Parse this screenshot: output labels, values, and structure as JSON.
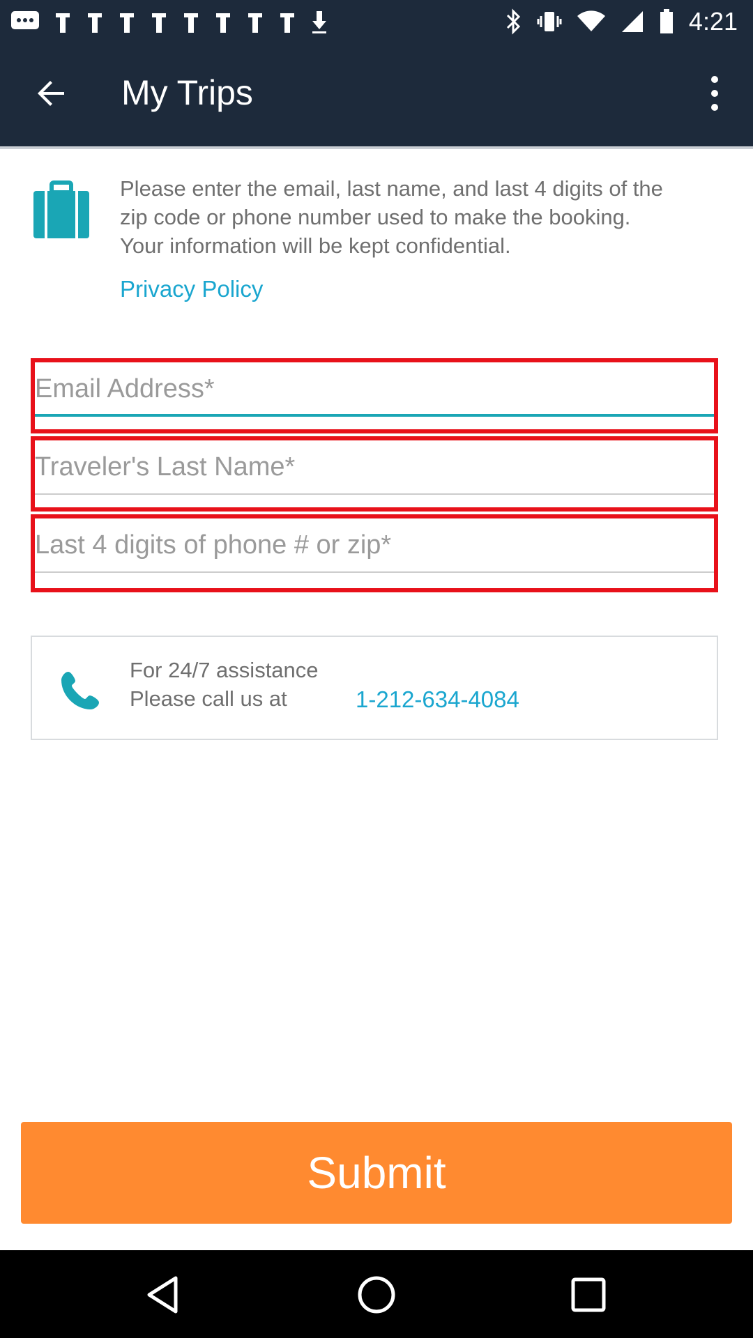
{
  "status_bar": {
    "time": "4:21",
    "left_icons": [
      "chat-bubble-icon",
      "notification-icon",
      "notification-icon",
      "notification-icon",
      "notification-icon",
      "notification-icon",
      "notification-icon",
      "notification-icon",
      "notification-icon",
      "download-icon"
    ],
    "right_icons": [
      "bluetooth-icon",
      "vibrate-icon",
      "wifi-icon",
      "signal-icon",
      "battery-icon"
    ]
  },
  "app_bar": {
    "title": "My Trips",
    "back_icon": "arrow-back-icon",
    "more_icon": "more-vert-icon"
  },
  "info": {
    "icon": "briefcase-icon",
    "text": "Please enter the email, last name, and last 4 digits of the zip code or phone number used to make the booking. Your information will be kept confidential.",
    "privacy_link": "Privacy Policy"
  },
  "form": {
    "email_placeholder": "Email Address*",
    "email_value": "",
    "last_name_placeholder": "Traveler's Last Name*",
    "last_name_value": "",
    "digits_placeholder": "Last 4 digits of phone # or zip*",
    "digits_value": ""
  },
  "assistance": {
    "icon": "phone-icon",
    "line1": "For 24/7 assistance",
    "line2": "Please call us at",
    "phone_number": "1-212-634-4084"
  },
  "submit_label": "Submit",
  "colors": {
    "bar_bg": "#1d2a3b",
    "accent_teal": "#1aa6cf",
    "submit_orange": "#ff8a30",
    "highlight_red": "#e8111a"
  },
  "nav_bar": {
    "icons": [
      "back-triangle-icon",
      "home-circle-icon",
      "recents-square-icon"
    ]
  }
}
